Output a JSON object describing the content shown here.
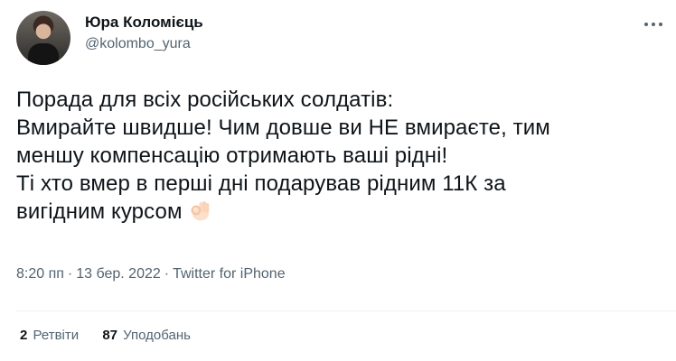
{
  "author": {
    "display_name": "Юра Коломієць",
    "handle": "@kolombo_yura"
  },
  "tweet": {
    "lines": [
      "Порада для всіх російських солдатів:",
      "Вмирайте швидше! Чим довше ви НЕ вмираєте, тим",
      "меншу компенсацію отримають ваші рідні!",
      "Ті хто вмер в перші дні подарував рідним 11К за",
      "вигідним курсом"
    ],
    "emoji": "ok-hand-icon"
  },
  "meta": {
    "time": "8:20 пп",
    "separator": "·",
    "date": "13 бер. 2022",
    "source": "Twitter for iPhone"
  },
  "stats": {
    "retweets_count": "2",
    "retweets_label": "Ретвіти",
    "likes_count": "87",
    "likes_label": "Уподобань"
  },
  "colors": {
    "text": "#0f1419",
    "secondary": "#536471",
    "divider": "#eff3f4"
  }
}
